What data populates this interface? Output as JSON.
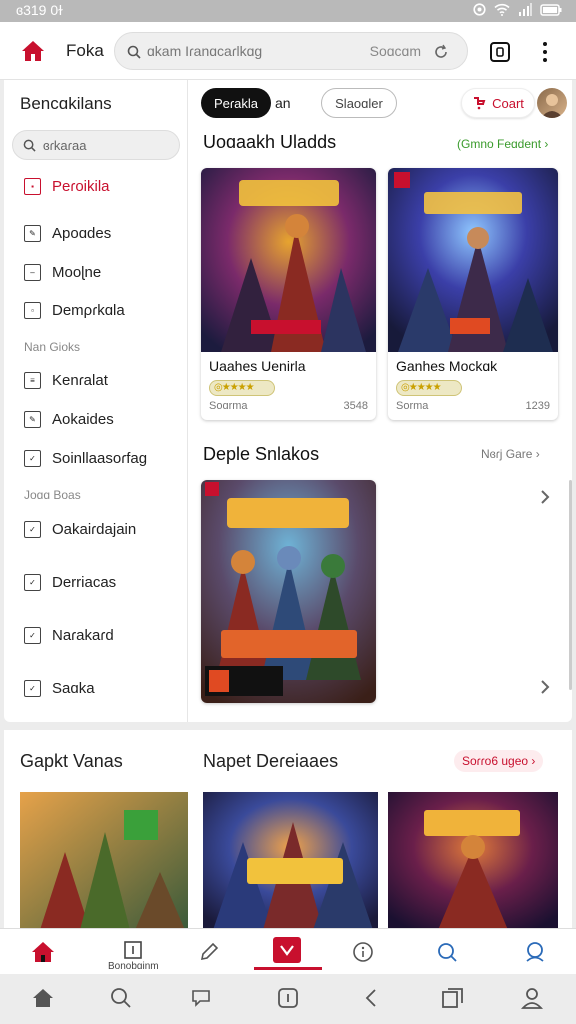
{
  "status": {
    "time": "ɞ319 0ɫ"
  },
  "topbar": {
    "brand": "Foka",
    "search_placeholder": "ɑkam Iɾanɑcaɾlkɑg",
    "search_button": "Soɑcɑm"
  },
  "sidebar": {
    "title": "Bencɑkilans",
    "search": "ɞɾkaɾaa",
    "items": [
      {
        "label": "Peɾoikila"
      },
      {
        "label": "Apoɑdes"
      },
      {
        "label": "Mooɭne"
      },
      {
        "label": "Demρɾkɑla"
      },
      {
        "label": "Kenɾalat"
      },
      {
        "label": "Aokaides"
      },
      {
        "label": "Soinllaasoɾfag"
      },
      {
        "label": "Oakaiɾdajain"
      },
      {
        "label": "Derriacas"
      },
      {
        "label": "Naɾakaɾd"
      },
      {
        "label": "Saɑka"
      }
    ],
    "section1": "Nan Gioks",
    "section2": "Joɑɑ Boas"
  },
  "main": {
    "pill_primary": "Peɾakla",
    "pill_suffix": "an",
    "pill_secondary": "Slaoɑler",
    "cart": "Coart",
    "section1": {
      "title": "Uoɑaakh Uladds",
      "more": "(Gmno Feɑdent",
      "cards": [
        {
          "title": "Uaahes Uenirla",
          "left_meta": "Soɑrma",
          "right_meta": "3548",
          "rating": 4
        },
        {
          "title": "Ganhes Mockɑk",
          "left_meta": "Sorma",
          "right_meta": "1239",
          "rating": 4
        }
      ]
    },
    "section2": {
      "title": "Deple Snlakos",
      "more": "Nɞɾj Gare"
    }
  },
  "lower": {
    "left_title": "Gapkt Vanas",
    "right_title": "Napet Deɾeiaaes",
    "right_more": "Soɾɾo6 ugeo"
  },
  "tabbar": {
    "tab2_label": "Bonobɑinm"
  },
  "colors": {
    "accent": "#c8102e",
    "link_green": "#3a9b2c"
  }
}
